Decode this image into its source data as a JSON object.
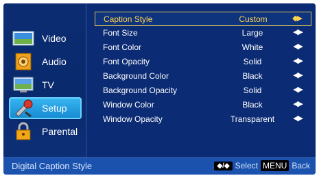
{
  "sidebar": {
    "items": [
      {
        "label": "Video",
        "icon": "video-icon"
      },
      {
        "label": "Audio",
        "icon": "audio-icon"
      },
      {
        "label": "TV",
        "icon": "tv-icon"
      },
      {
        "label": "Setup",
        "icon": "setup-icon",
        "active": true
      },
      {
        "label": "Parental",
        "icon": "lock-icon"
      }
    ]
  },
  "menu": {
    "rows": [
      {
        "name": "Caption Style",
        "value": "Custom",
        "arrows": "◆▶"
      },
      {
        "name": "Font Size",
        "value": "Large",
        "arrows": "◀▶"
      },
      {
        "name": "Font Color",
        "value": "White",
        "arrows": "◀▶"
      },
      {
        "name": "Font Opacity",
        "value": "Solid",
        "arrows": "◀▶"
      },
      {
        "name": "Background Color",
        "value": "Black",
        "arrows": "◀▶"
      },
      {
        "name": "Background Opacity",
        "value": "Solid",
        "arrows": "◀▶"
      },
      {
        "name": "Window Color",
        "value": "Black",
        "arrows": "◀▶"
      },
      {
        "name": "Window Opacity",
        "value": "Transparent",
        "arrows": "◀▶"
      }
    ]
  },
  "footer": {
    "title": "Digital Caption Style",
    "nav_key": "◆/◆",
    "select_label": "Select",
    "menu_key": "MENU",
    "back_label": "Back"
  },
  "colors": {
    "highlight": "#ffd24c",
    "background": "#0b2b74",
    "footer": "#1b52ad"
  }
}
